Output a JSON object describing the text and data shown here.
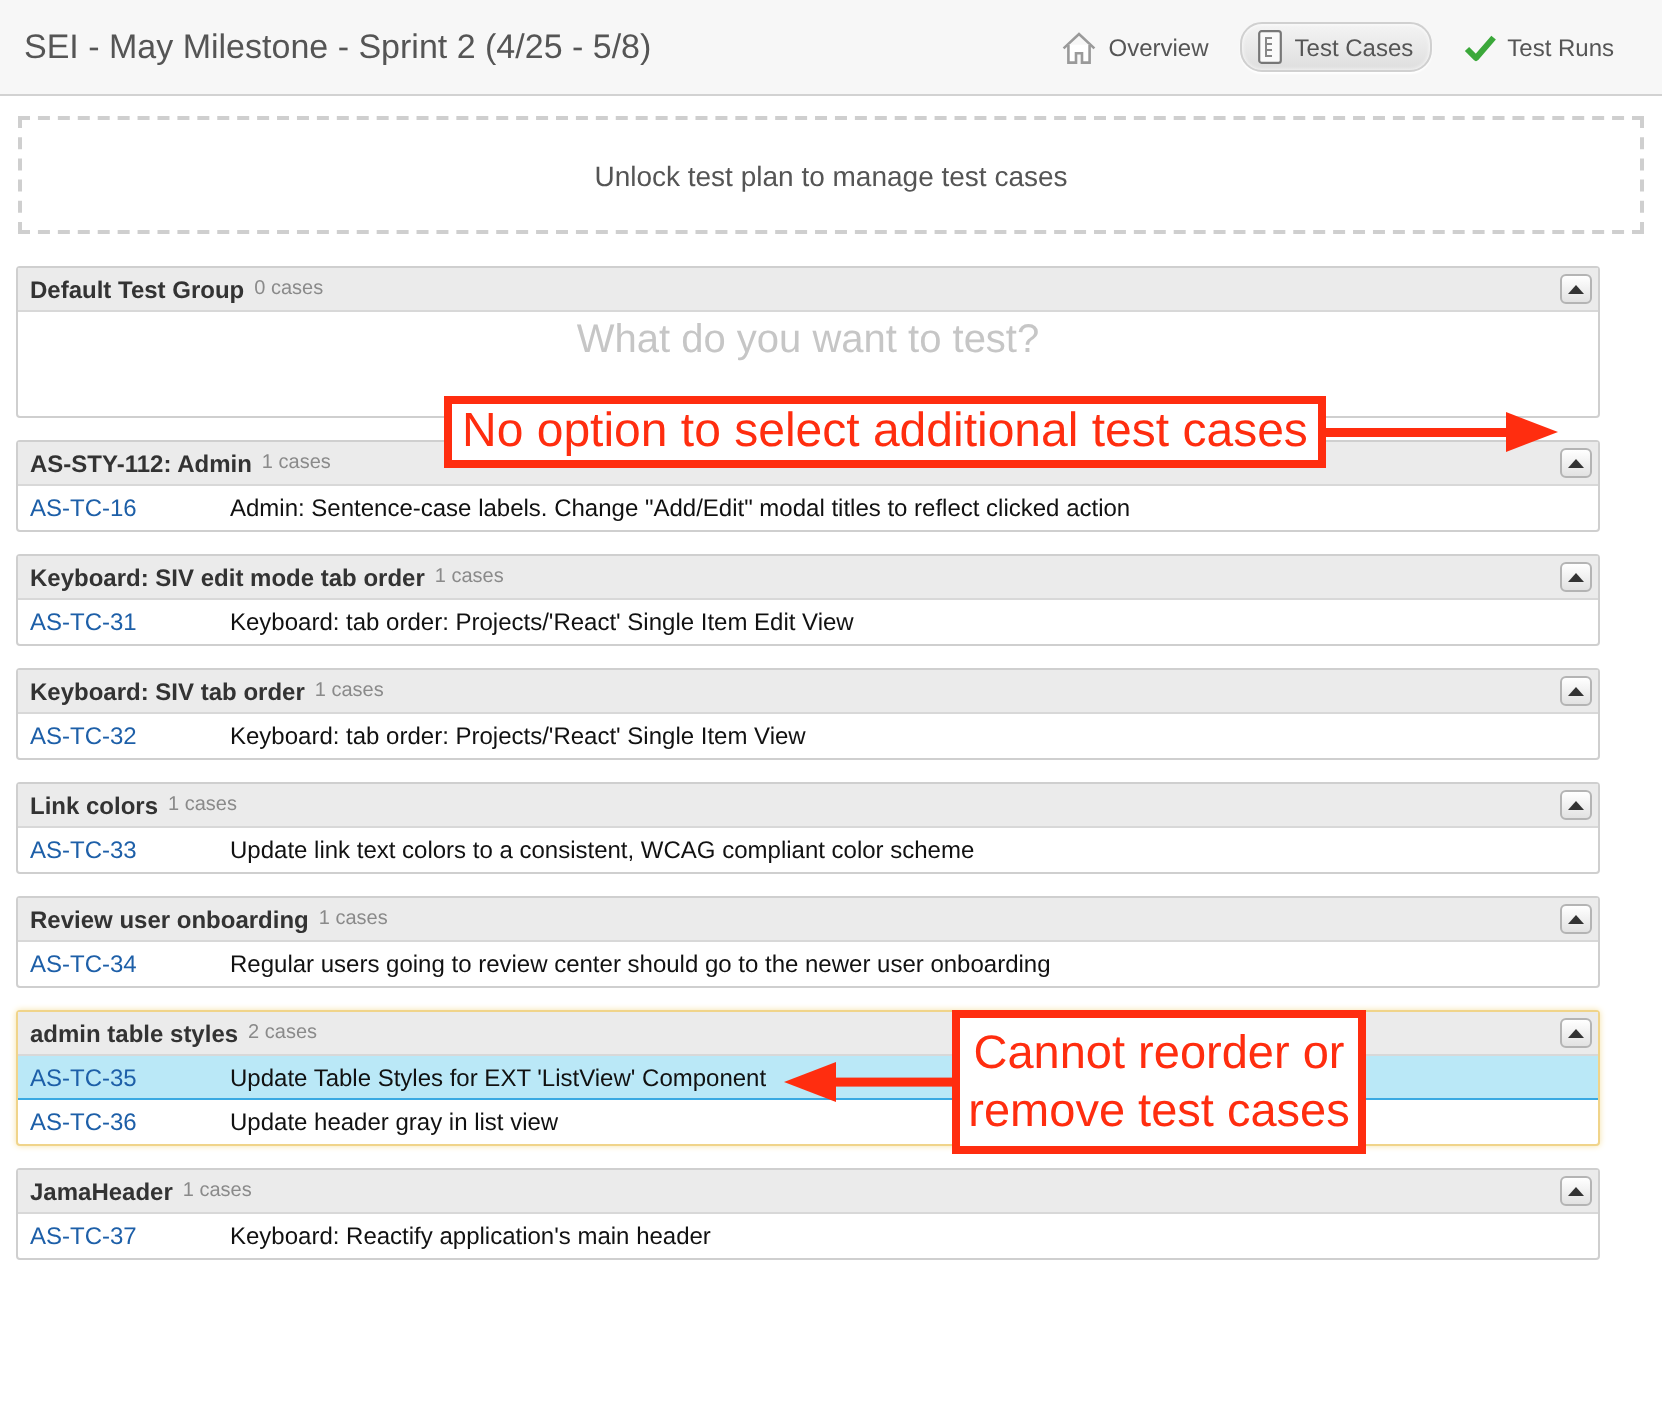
{
  "header": {
    "title": "SEI - May Milestone - Sprint 2 (4/25 - 5/8)",
    "nav": [
      {
        "label": "Overview",
        "selected": false
      },
      {
        "label": "Test Cases",
        "selected": true
      },
      {
        "label": "Test Runs",
        "selected": false
      }
    ]
  },
  "lock_banner": {
    "text": "Unlock test plan to manage test cases"
  },
  "groups": [
    {
      "title": "Default Test Group",
      "count": "0 cases",
      "selected": false,
      "expanded": true,
      "empty_state": {
        "title": "What do you want to test?"
      }
    },
    {
      "title": "AS-STY-112: Admin",
      "count": "1 cases",
      "selected": false,
      "expanded": true,
      "cases": [
        {
          "id": "AS-TC-16",
          "name": "Admin: Sentence-case labels. Change \"Add/Edit\" modal titles to reflect clicked action",
          "selected": false
        }
      ]
    },
    {
      "title": "Keyboard: SIV edit mode tab order",
      "count": "1 cases",
      "selected": false,
      "expanded": true,
      "cases": [
        {
          "id": "AS-TC-31",
          "name": "Keyboard: tab order: Projects/'React' Single Item Edit View",
          "selected": false
        }
      ]
    },
    {
      "title": "Keyboard: SIV tab order",
      "count": "1 cases",
      "selected": false,
      "expanded": true,
      "cases": [
        {
          "id": "AS-TC-32",
          "name": "Keyboard: tab order: Projects/'React' Single Item View",
          "selected": false
        }
      ]
    },
    {
      "title": "Link colors",
      "count": "1 cases",
      "selected": false,
      "expanded": true,
      "cases": [
        {
          "id": "AS-TC-33",
          "name": "Update link text colors to a consistent, WCAG compliant color scheme",
          "selected": false
        }
      ]
    },
    {
      "title": "Review user onboarding",
      "count": "1 cases",
      "selected": false,
      "expanded": true,
      "cases": [
        {
          "id": "AS-TC-34",
          "name": "Regular users going to review center should go to the newer user onboarding",
          "selected": false
        }
      ]
    },
    {
      "title": "admin table styles",
      "count": "2 cases",
      "selected": true,
      "expanded": true,
      "cases": [
        {
          "id": "AS-TC-35",
          "name": "Update Table Styles for EXT 'ListView' Component",
          "selected": true
        },
        {
          "id": "AS-TC-36",
          "name": "Update header gray in list view",
          "selected": false
        }
      ]
    },
    {
      "title": "JamaHeader",
      "count": "1 cases",
      "selected": false,
      "expanded": true,
      "cases": [
        {
          "id": "AS-TC-37",
          "name": "Keyboard: Reactify application's main header",
          "selected": false
        }
      ]
    }
  ],
  "annotations": [
    {
      "text": "No option to select additional test cases",
      "kind": "right"
    },
    {
      "text": "Cannot reorder or remove test cases",
      "kind": "left"
    }
  ]
}
